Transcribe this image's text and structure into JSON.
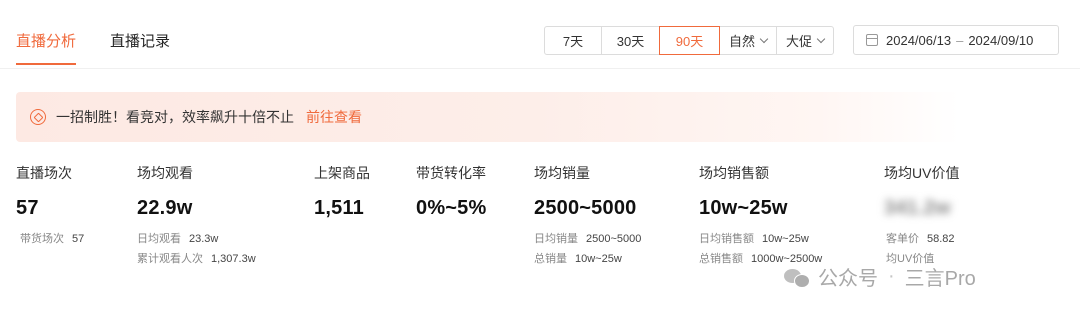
{
  "tabs": {
    "live_analysis": "直播分析",
    "live_records": "直播记录"
  },
  "range": {
    "d7": "7天",
    "d30": "30天",
    "d90": "90天",
    "natural": "自然",
    "promo": "大促",
    "date_start": "2024/06/13",
    "date_sep": "–",
    "date_end": "2024/09/10"
  },
  "banner": {
    "text": "一招制胜！看竞对，效率飙升十倍不止",
    "link": "前往查看"
  },
  "metrics": {
    "sessions": {
      "label": "直播场次",
      "value": "57",
      "sub1_label": "带货场次",
      "sub1_value": "57"
    },
    "avg_views": {
      "label": "场均观看",
      "value": "22.9w",
      "sub1_label": "日均观看",
      "sub1_value": "23.3w",
      "sub2_label": "累计观看人次",
      "sub2_value": "1,307.3w"
    },
    "products": {
      "label": "上架商品",
      "value": "1,511"
    },
    "conversion": {
      "label": "带货转化率",
      "value": "0%~5%"
    },
    "avg_sales": {
      "label": "场均销量",
      "value": "2500~5000",
      "sub1_label": "日均销量",
      "sub1_value": "2500~5000",
      "sub2_label": "总销量",
      "sub2_value": "10w~25w"
    },
    "avg_revenue": {
      "label": "场均销售额",
      "value": "10w~25w",
      "sub1_label": "日均销售额",
      "sub1_value": "10w~25w",
      "sub2_label": "总销售额",
      "sub2_value": "1000w~2500w"
    },
    "uv_value": {
      "label": "场均UV价值",
      "value": "341.2w",
      "sub1_label": "客单价",
      "sub1_value": "58.82",
      "sub2_label": "均UV价值"
    }
  },
  "watermark": {
    "brand": "公众号",
    "sep": "·",
    "name": "三言Pro"
  },
  "colors": {
    "accent": "#f06a3c"
  }
}
